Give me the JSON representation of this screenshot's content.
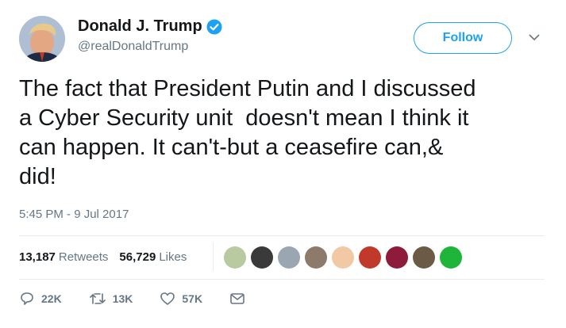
{
  "user": {
    "display_name": "Donald J. Trump",
    "handle": "@realDonaldTrump",
    "verified": true,
    "verified_icon": "verified-badge-icon"
  },
  "follow_label": "Follow",
  "tweet": {
    "text": "The fact that President Putin and I discussed\na Cyber Security unit  doesn't mean I think it\ncan happen. It can't-but a ceasefire can,&\ndid!",
    "timestamp": "5:45 PM - 9 Jul 2017"
  },
  "stats": {
    "retweets_count": "13,187",
    "retweets_label": "Retweets",
    "likes_count": "56,729",
    "likes_label": "Likes"
  },
  "likers": [
    {
      "color": "#b9c9a0"
    },
    {
      "color": "#3a3a3a"
    },
    {
      "color": "#9aa7b3"
    },
    {
      "color": "#8c7a6b"
    },
    {
      "color": "#f2c9a5"
    },
    {
      "color": "#c0392b"
    },
    {
      "color": "#8e1b3c"
    },
    {
      "color": "#6b5a45"
    },
    {
      "color": "#1eb53a"
    }
  ],
  "actions": {
    "reply_count": "22K",
    "retweet_count": "13K",
    "like_count": "57K"
  },
  "colors": {
    "accent": "#1da1f2",
    "secondary_text": "#657786"
  }
}
